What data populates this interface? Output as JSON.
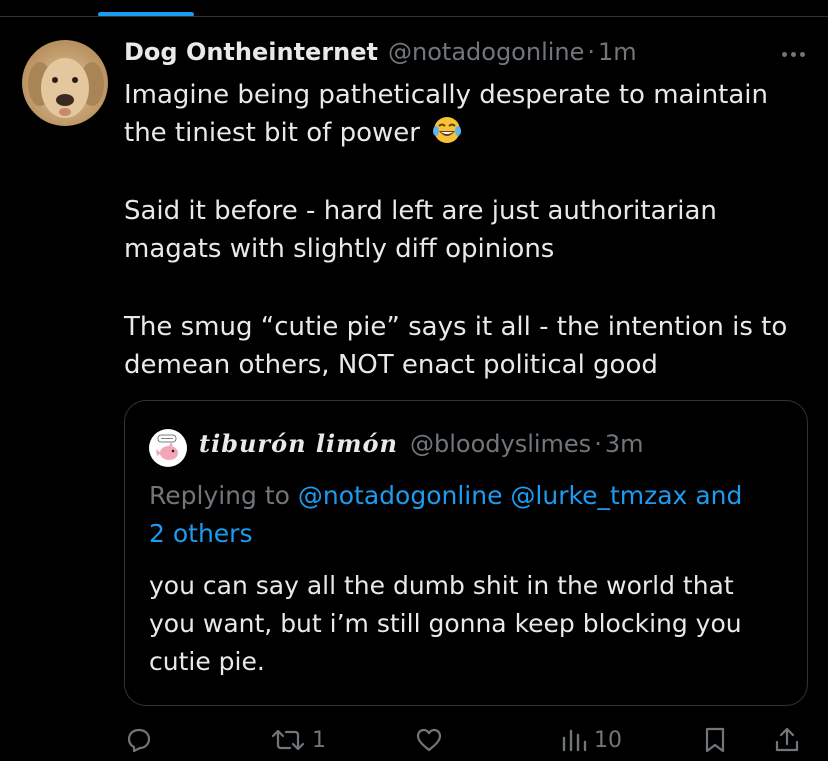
{
  "tweet": {
    "display_name": "Dog Ontheinternet",
    "handle": "@notadogonline",
    "separator": "·",
    "time": "1m",
    "body_lines": [
      "Imagine being pathetically desperate to maintain",
      "the tiniest bit of power",
      "Said it before - hard left are just authoritarian",
      "magats with slightly diff opinions",
      "The smug “cutie pie” says it all - the intention is to",
      "demean others, NOT enact political good"
    ],
    "emoji": "face-with-tears-of-joy"
  },
  "quote": {
    "display_name": "tiburón limón",
    "handle": "@bloodyslimes",
    "separator": "·",
    "time": "3m",
    "replying_prefix": "Replying to",
    "mention_1": "@notadogonline",
    "mention_2": "@lurke_tmzax",
    "mention_3": "and",
    "mention_4": "2 others",
    "text_lines": [
      "you can say all the dumb shit in the world that",
      "you want, but i’m still gonna keep blocking you",
      "cutie pie."
    ]
  },
  "actions": {
    "reply_icon": "reply-icon",
    "retweet_count": "1",
    "like_icon": "heart-icon",
    "views_count": "10",
    "bookmark_icon": "bookmark-icon",
    "share_icon": "share-icon"
  },
  "colors": {
    "background": "#000000",
    "text": "#e7e9ea",
    "secondary": "#71767b",
    "accent": "#1d9bf0",
    "border": "#2f3336"
  }
}
